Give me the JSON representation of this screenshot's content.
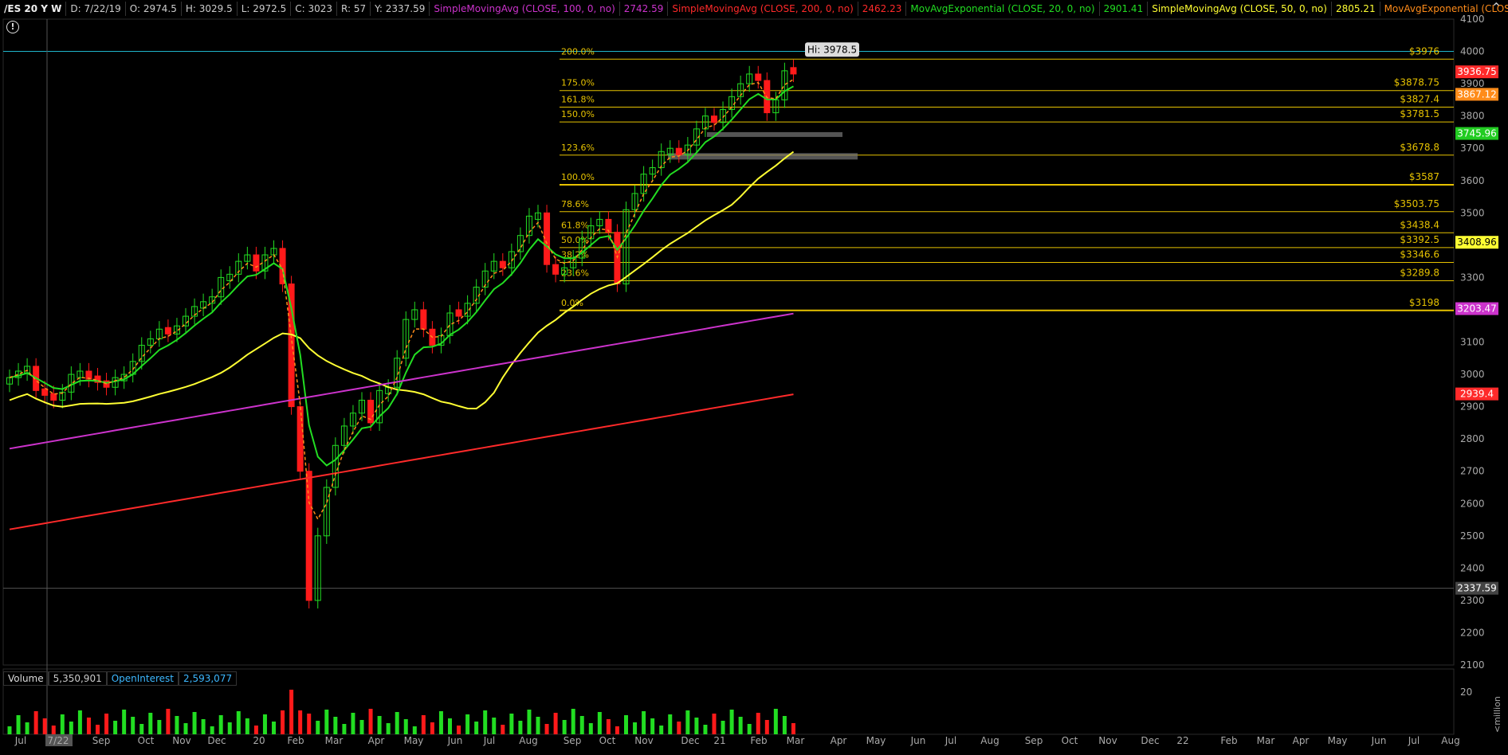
{
  "header": {
    "symbol": "/ES 20 Y W",
    "date": "D: 7/22/19",
    "open": "O: 2974.5",
    "high": "H: 3029.5",
    "low": "L: 2972.5",
    "close": "C: 3023",
    "range": "R: 57",
    "y": "Y: 2337.59",
    "indicators": [
      {
        "label": "SimpleMovingAvg (CLOSE, 100, 0, no)",
        "value": "2742.59",
        "color": "#cc33cc"
      },
      {
        "label": "SimpleMovingAvg (CLOSE, 200, 0, no)",
        "value": "2462.23",
        "color": "#ff2a2a"
      },
      {
        "label": "MovAvgExponential (CLOSE, 20, 0, no)",
        "value": "2901.41",
        "color": "#22dd22"
      },
      {
        "label": "SimpleMovingAvg (CLOSE, 50, 0, no)",
        "value": "2805.21",
        "color": "#ffff33"
      },
      {
        "label": "MovAvgExponential (CLOSE, 8,...",
        "value": "",
        "color": "#ff8c1a"
      }
    ]
  },
  "volume_header": {
    "volume_label": "Volume",
    "volume_value": "5,350,901",
    "oi_label": "OpenInterest",
    "oi_value": "2,593,077"
  },
  "chart_data": {
    "type": "candlestick",
    "price_axis": [
      4100,
      4000,
      3900,
      3800,
      3700,
      3600,
      3500,
      3400,
      3300,
      3200,
      3100,
      3000,
      2900,
      2800,
      2700,
      2600,
      2500,
      2400,
      2300,
      2200,
      2100
    ],
    "ylim": [
      2100,
      4100
    ],
    "volume_axis": [
      "20"
    ],
    "volume_unit": "<million",
    "x_labels": [
      "Jul",
      "7/22",
      "Sep",
      "Oct",
      "Nov",
      "Dec",
      "20",
      "Feb",
      "Mar",
      "Apr",
      "May",
      "Jun",
      "Jul",
      "Aug",
      "Sep",
      "Oct",
      "Nov",
      "Dec",
      "21",
      "Feb",
      "Mar",
      "Apr",
      "May",
      "Jun",
      "Jul",
      "Aug",
      "Sep",
      "Oct",
      "Nov",
      "Dec",
      "22",
      "Feb",
      "Mar",
      "Apr",
      "May",
      "Jun",
      "Jul",
      "Aug"
    ],
    "candles_close": [
      2990,
      3010,
      3025,
      2950,
      2935,
      2920,
      2945,
      3000,
      3010,
      2985,
      2975,
      2960,
      2990,
      3000,
      3040,
      3090,
      3110,
      3140,
      3125,
      3150,
      3180,
      3210,
      3225,
      3240,
      3300,
      3310,
      3350,
      3370,
      3320,
      3370,
      3390,
      3280,
      2900,
      2700,
      2300,
      2500,
      2650,
      2780,
      2840,
      2880,
      2920,
      2850,
      2950,
      2960,
      3050,
      3170,
      3200,
      3140,
      3090,
      3120,
      3190,
      3180,
      3220,
      3270,
      3320,
      3350,
      3330,
      3380,
      3430,
      3490,
      3500,
      3340,
      3310,
      3330,
      3360,
      3420,
      3460,
      3480,
      3440,
      3280,
      3510,
      3560,
      3620,
      3640,
      3690,
      3700,
      3680,
      3710,
      3760,
      3800,
      3780,
      3820,
      3860,
      3900,
      3930,
      3910,
      3810,
      3850,
      3940,
      3930
    ],
    "candle_up": [
      true,
      true,
      true,
      false,
      false,
      false,
      true,
      true,
      true,
      false,
      false,
      false,
      true,
      true,
      true,
      true,
      true,
      true,
      false,
      true,
      true,
      true,
      true,
      true,
      true,
      true,
      true,
      true,
      false,
      true,
      true,
      false,
      false,
      false,
      false,
      true,
      true,
      true,
      true,
      true,
      true,
      false,
      true,
      true,
      true,
      true,
      true,
      false,
      false,
      true,
      true,
      false,
      true,
      true,
      true,
      true,
      false,
      true,
      true,
      true,
      true,
      false,
      false,
      true,
      true,
      true,
      true,
      true,
      false,
      false,
      true,
      true,
      true,
      true,
      true,
      true,
      false,
      true,
      true,
      true,
      false,
      true,
      true,
      true,
      true,
      false,
      false,
      true,
      true,
      false
    ],
    "fib_levels": [
      {
        "pct": "200.0%",
        "price": "$3976",
        "value": 3976
      },
      {
        "pct": "175.0%",
        "price": "$3878.75",
        "value": 3878.75
      },
      {
        "pct": "161.8%",
        "price": "$3827.4",
        "value": 3827.4
      },
      {
        "pct": "150.0%",
        "price": "$3781.5",
        "value": 3781.5
      },
      {
        "pct": "123.6%",
        "price": "$3678.8",
        "value": 3678.8
      },
      {
        "pct": "100.0%",
        "price": "$3587",
        "value": 3587
      },
      {
        "pct": "78.6%",
        "price": "$3503.75",
        "value": 3503.75
      },
      {
        "pct": "61.8%",
        "price": "$3438.4",
        "value": 3438.4
      },
      {
        "pct": "50.0%",
        "price": "$3392.5",
        "value": 3392.5
      },
      {
        "pct": "38.2%",
        "price": "$3346.6",
        "value": 3346.6
      },
      {
        "pct": "23.6%",
        "price": "$3289.8",
        "value": 3289.8
      },
      {
        "pct": "0.0%",
        "price": "$3198",
        "value": 3198
      }
    ],
    "price_tags": [
      {
        "text": "3936.75",
        "value": 3936.75,
        "color": "#ff2a2a"
      },
      {
        "text": "3867.12",
        "value": 3867.12,
        "color": "#ff8c1a"
      },
      {
        "text": "3745.96",
        "value": 3745.96,
        "color": "#22cc22"
      },
      {
        "text": "3408.96",
        "value": 3408.96,
        "color": "#ffff33"
      },
      {
        "text": "3203.47",
        "value": 3203.47,
        "color": "#cc33cc"
      },
      {
        "text": "2939.4",
        "value": 2939.4,
        "color": "#ff2a2a"
      },
      {
        "text": "2337.59",
        "value": 2337.59,
        "color": "#444444"
      }
    ],
    "hi_label": "Hi: 3978.5",
    "hi_value": 3978.5,
    "crosshair_price": 2337.59,
    "cyan_line_price": 4000,
    "demand_zones": [
      [
        3740,
        3750
      ],
      [
        3670,
        3685
      ]
    ]
  },
  "colors": {
    "up": "#22dd22",
    "down": "#ff1a1a",
    "fib": "#e6c200",
    "axis_text": "#aaaaaa",
    "grid": "#333333"
  }
}
